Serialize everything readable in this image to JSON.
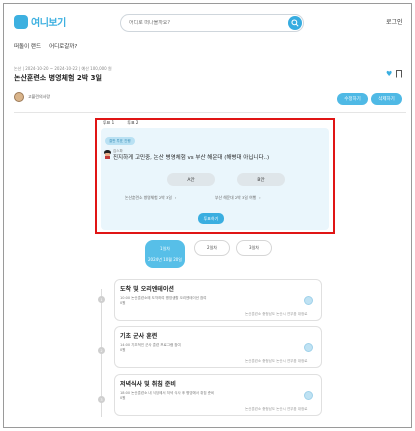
{
  "header": {
    "logo_text": "여니보기",
    "search_placeholder": "어디로 떠나볼까요?",
    "login_label": "로그인"
  },
  "nav": {
    "items": [
      "떠돌이 랜드",
      "어디로갈까?"
    ]
  },
  "trip": {
    "meta": "논산 | 2024-10-20 ~ 2024-10-22 | 예산 100,000 원",
    "title": "논산훈련소 병영체험 2박 3일",
    "author": "고블린의사랑",
    "edit_label": "수정하기",
    "delete_label": "삭제하기"
  },
  "poll": {
    "tabs": [
      "투표 1",
      "투표 2"
    ],
    "badge": "결판 투표 진행",
    "user": "김스파",
    "question": "진지하게 고민중, 논산 병영체험 vs 부산 해운대 (해병대 아닙니다..)",
    "option_a": "A안",
    "option_b": "B안",
    "link_a": "논산훈련소 병영체험 2박 3일",
    "link_b": "부산 해운대 2박 3일 여행",
    "vote_label": "투표하기"
  },
  "days": {
    "day1_label": "1일차",
    "day1_date": "2024년 10월 20일",
    "day2_label": "2일차",
    "day3_label": "3일차"
  },
  "schedule": [
    {
      "num": "1",
      "title": "도착 및 오리엔테이션",
      "desc": "10:00 논산훈련소에 도착하여 병영생활 오리엔테이션 참여",
      "price": "0원",
      "loc": "논산훈련소 충청남도 논산시 연무읍 대정로"
    },
    {
      "num": "2",
      "title": "기초 군사 훈련",
      "desc": "14:00 기초적인 군사 훈련 프로그램 참여",
      "price": "0원",
      "loc": "논산훈련소 충청남도 논산시 연무읍 대정로"
    },
    {
      "num": "3",
      "title": "저녁식사 및 취침 준비",
      "desc": "18:00 논산훈련소 내 식당에서 저녁 식사 후 병영에서 취침 준비",
      "price": "0원",
      "loc": "논산훈련소 충청남도 논산시 연무읍 대정로"
    }
  ],
  "colors": {
    "accent": "#3aaee0",
    "highlight_border": "#e01515",
    "poll_bg": "#eaf6fc"
  }
}
